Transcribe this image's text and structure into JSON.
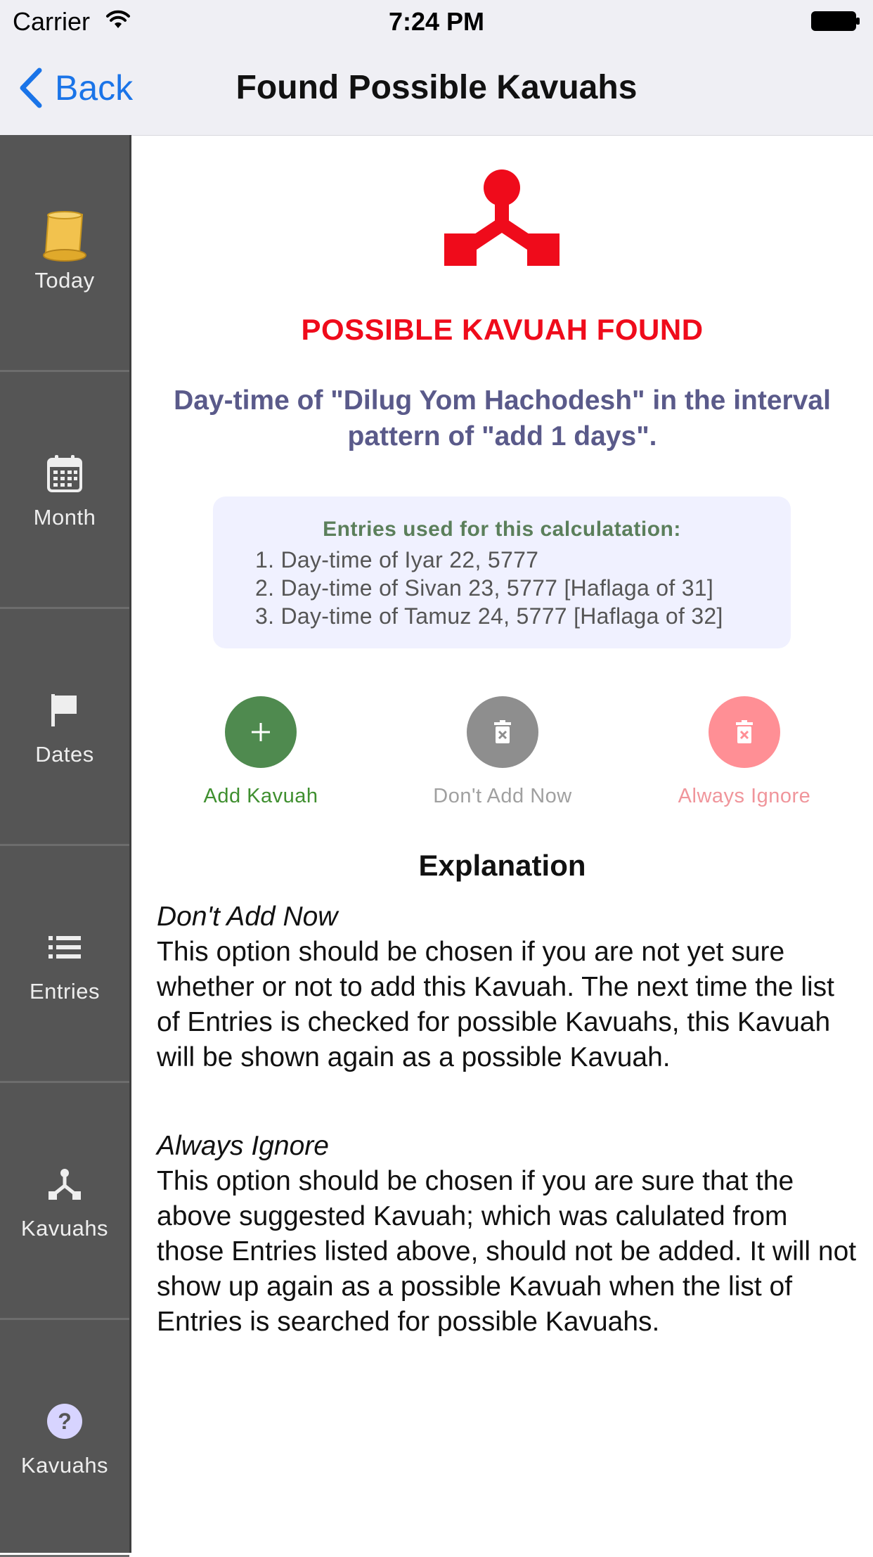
{
  "status_bar": {
    "carrier": "Carrier",
    "time": "7:24 PM"
  },
  "nav": {
    "back_label": "Back",
    "title": "Found Possible Kavuahs"
  },
  "sidebar": {
    "items": [
      {
        "label": "Today",
        "icon": "scroll-icon"
      },
      {
        "label": "Month",
        "icon": "calendar-icon"
      },
      {
        "label": "Dates",
        "icon": "flag-icon"
      },
      {
        "label": "Entries",
        "icon": "list-icon"
      },
      {
        "label": "Kavuahs",
        "icon": "kavuah-icon"
      },
      {
        "label": "Kavuahs",
        "icon": "help-icon"
      }
    ]
  },
  "main": {
    "found_title": "POSSIBLE KAVUAH FOUND",
    "description": "Day-time of \"Dilug Yom Hachodesh\" in the interval pattern of \"add 1 days\".",
    "entries_heading": "Entries used for this calculatation:",
    "entries": [
      "1. Day-time of Iyar 22, 5777",
      "2. Day-time of Sivan 23, 5777 [Haflaga of 31]",
      "3. Day-time of Tamuz 24, 5777 [Haflaga of 32]"
    ],
    "actions": {
      "add": {
        "label": "Add Kavuah",
        "color": "#4f8a4f",
        "text_color": "#3f8f2f"
      },
      "dont_add": {
        "label": "Don't Add Now",
        "color": "#8e8e8e",
        "text_color": "#a0a0a0"
      },
      "ignore": {
        "label": "Always Ignore",
        "color": "#ff8f95",
        "text_color": "#f0959b"
      }
    },
    "explanation_title": "Explanation",
    "explanations": [
      {
        "heading": "Don't Add Now",
        "body": "This option should be chosen if you are not yet sure whether or not to add this Kavuah. The next time the list of Entries is checked for possible Kavuahs, this Kavuah will be shown again as a possible Kavuah."
      },
      {
        "heading": "Always Ignore",
        "body": "This option should be chosen if you are sure that the above suggested Kavuah; which was calulated from those Entries listed above, should not be added. It will not show up again as a possible Kavuah when the list of Entries is searched for possible Kavuahs."
      }
    ]
  },
  "colors": {
    "accent_red": "#ef0b1b",
    "ios_blue": "#1a74e8",
    "sidebar_bg": "#555555",
    "description_text": "#5a5a8a",
    "entries_box_bg": "#f0f1ff"
  }
}
